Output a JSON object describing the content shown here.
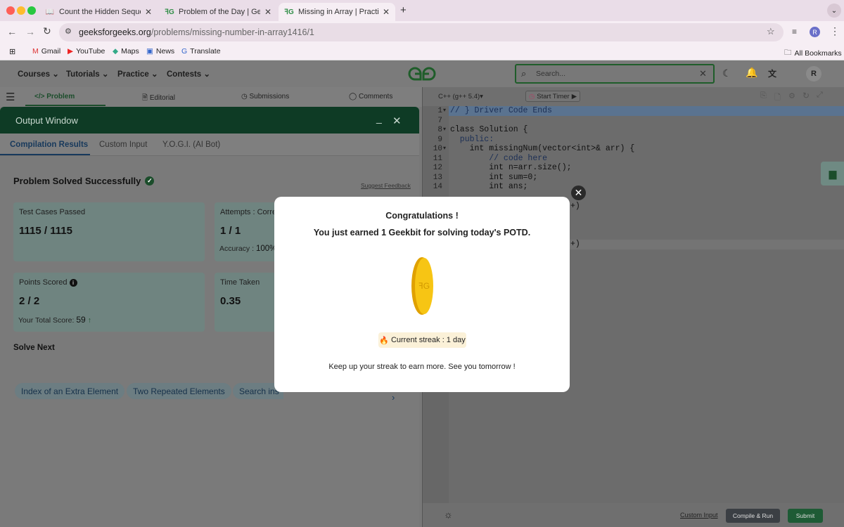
{
  "browser": {
    "tabs": [
      {
        "label": "Count the Hidden Sequences",
        "favicon": "reading-icon"
      },
      {
        "label": "Problem of the Day | GeeksforGeeks",
        "favicon": "gfg-icon"
      },
      {
        "label": "Missing in Array | Practice | GeeksforGeeks",
        "favicon": "gfg-icon"
      }
    ],
    "url_domain": "geeksforgeeks.org",
    "url_path": "/problems/missing-number-in-array1416/1",
    "profile_initial": "R",
    "bookmarks": [
      "Gmail",
      "YouTube",
      "Maps",
      "News",
      "Translate"
    ],
    "all_bookmarks": "All Bookmarks"
  },
  "site": {
    "nav": [
      "Courses",
      "Tutorials",
      "Practice",
      "Contests"
    ],
    "search_placeholder": "Search...",
    "avatar": "R"
  },
  "problem_tabs": [
    "Problem",
    "Editorial",
    "Submissions",
    "Comments"
  ],
  "output": {
    "title": "Output Window",
    "tabs": [
      "Compilation Results",
      "Custom Input",
      "Y.O.G.I. (AI Bot)"
    ],
    "status": "Problem Solved Successfully",
    "suggest_feedback": "Suggest Feedback",
    "cards": {
      "tests_label": "Test Cases Passed",
      "tests_value": "1115 / 1115",
      "attempts_label": "Attempts : Corre",
      "attempts_value": "1 / 1",
      "accuracy_label": "Accuracy :",
      "accuracy_value": "100%",
      "points_label": "Points Scored",
      "points_value": "2 / 2",
      "total_label": "Your Total Score:",
      "total_value": "59",
      "time_label": "Time Taken",
      "time_value": "0.35"
    },
    "solve_next": "Solve Next",
    "next_items": [
      "Index of an Extra Element",
      "Two Repeated Elements",
      "Search ins"
    ]
  },
  "editor": {
    "language": "C++ (g++ 5.4)",
    "timer": "Start Timer",
    "line_numbers": [
      "1",
      "7",
      "8",
      "9",
      "10",
      "11",
      "12",
      "13",
      "14"
    ],
    "lines": [
      "// } Driver Code Ends",
      "",
      "class Solution {",
      "  public:",
      "    int missingNum(vector<int>& arr) {",
      "        // code here",
      "        int n=arr.size();",
      "        int sum=0;",
      "        int ans;"
    ],
    "partial_line_1": "+)",
    "partial_line_2": "+)",
    "custom_input": "Custom Input",
    "compile_run": "Compile & Run",
    "submit": "Submit"
  },
  "modal": {
    "title": "Congratulations !",
    "message": "You just earned 1 Geekbit for solving today's POTD.",
    "streak": "Current streak : 1 day",
    "footer": "Keep up your streak to earn more. See you tomorrow !"
  }
}
